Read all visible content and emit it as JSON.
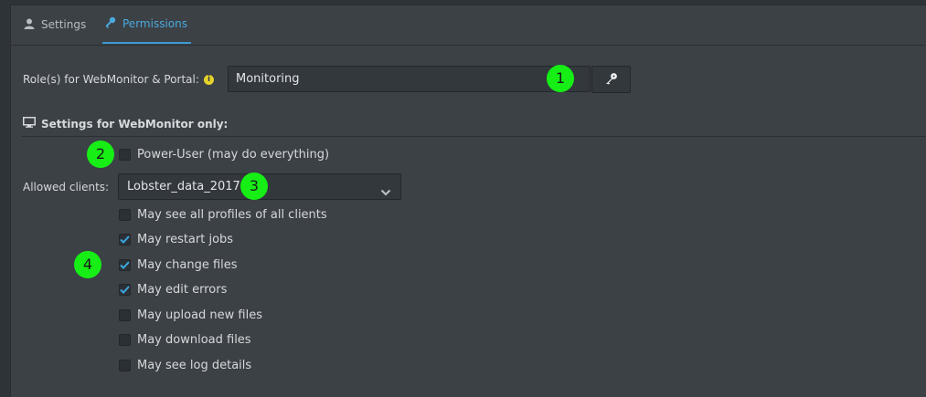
{
  "tabs": [
    {
      "label": "Settings",
      "icon": "user-icon",
      "active": false
    },
    {
      "label": "Permissions",
      "icon": "key-icon",
      "active": true
    }
  ],
  "roles": {
    "label": "Role(s) for WebMonitor & Portal:",
    "info_icon": "info-icon",
    "value": "Monitoring",
    "button_icon": "key-icon"
  },
  "section": {
    "icon": "monitor-icon",
    "title": "Settings for WebMonitor only:"
  },
  "power_user": {
    "label": "Power-User (may do everything)",
    "checked": false
  },
  "clients": {
    "label": "Allowed clients:",
    "selected": "Lobster_data_2017"
  },
  "permissions": [
    {
      "label": "May see all profiles of all clients",
      "checked": false
    },
    {
      "label": "May restart jobs",
      "checked": true
    },
    {
      "label": "May change files",
      "checked": true
    },
    {
      "label": "May edit errors",
      "checked": true
    },
    {
      "label": "May upload new files",
      "checked": false
    },
    {
      "label": "May download files",
      "checked": false
    },
    {
      "label": "May see log details",
      "checked": false
    }
  ],
  "markers": [
    "1",
    "2",
    "3",
    "4"
  ],
  "colors": {
    "accent": "#3d9ad5",
    "marker": "#16ee16",
    "info": "#e6d32a",
    "check": "#3aa6e0"
  }
}
